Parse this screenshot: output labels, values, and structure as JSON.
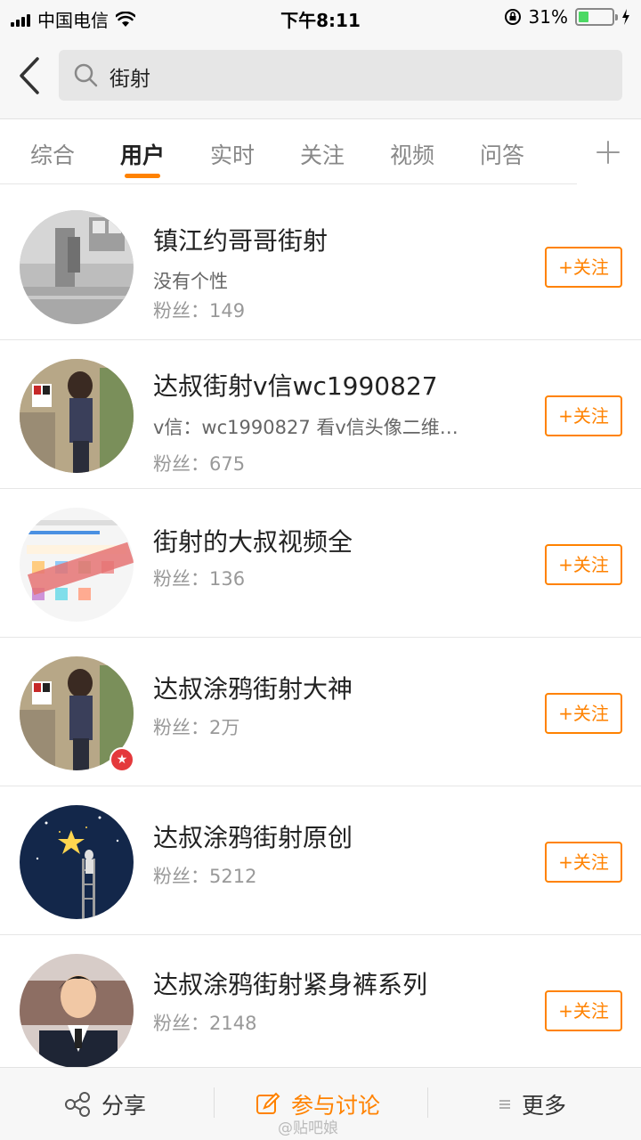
{
  "status_bar": {
    "carrier": "中国电信",
    "time": "下午8:11",
    "battery_percent": "31%",
    "battery_level": 0.31
  },
  "search": {
    "query": "街射"
  },
  "tabs": [
    {
      "label": "综合",
      "active": false
    },
    {
      "label": "用户",
      "active": true
    },
    {
      "label": "实时",
      "active": false
    },
    {
      "label": "关注",
      "active": false
    },
    {
      "label": "视频",
      "active": false
    },
    {
      "label": "问答",
      "active": false
    }
  ],
  "follow_label": "+关注",
  "users": [
    {
      "name": "镇江约哥哥街射",
      "desc": "没有个性",
      "fans": "粉丝：149"
    },
    {
      "name": "达叔街射v信wc1990827",
      "desc": "v信：wc1990827  看v信头像二维…",
      "fans": "粉丝：675"
    },
    {
      "name": "街射的大叔视频全",
      "fans": "粉丝：136"
    },
    {
      "name": "达叔涂鸦街射大神",
      "fans": "粉丝：2万"
    },
    {
      "name": "达叔涂鸦街射原创",
      "fans": "粉丝：5212"
    },
    {
      "name": "达叔涂鸦街射紧身裤系列",
      "fans": "粉丝：2148"
    }
  ],
  "bottom_bar": {
    "share": "分享",
    "discuss": "参与讨论",
    "more": "更多"
  },
  "watermark": "@贴吧娘",
  "colors": {
    "accent": "#ff8200",
    "badge": "#e4393c"
  }
}
